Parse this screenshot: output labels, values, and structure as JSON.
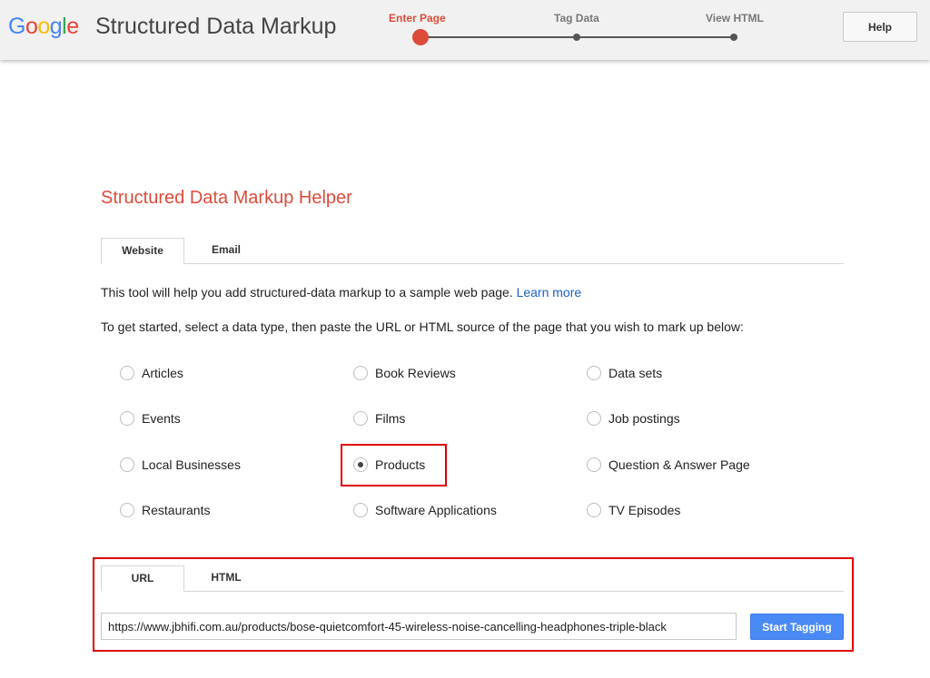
{
  "header": {
    "logo_text": "Google",
    "app_title": "Structured Data Markup",
    "steps": [
      {
        "label": "Enter Page",
        "active": true
      },
      {
        "label": "Tag Data",
        "active": false
      },
      {
        "label": "View HTML",
        "active": false
      }
    ],
    "help_label": "Help"
  },
  "main": {
    "title": "Structured Data Markup Helper",
    "source_tabs": [
      {
        "label": "Website",
        "active": true
      },
      {
        "label": "Email",
        "active": false
      }
    ],
    "intro_text": "This tool will help you add structured-data markup to a sample web page.",
    "learn_more": "Learn more",
    "instructions": "To get started, select a data type, then paste the URL or HTML source of the page that you wish to mark up below:",
    "data_types": [
      "Articles",
      "Book Reviews",
      "Data sets",
      "Events",
      "Films",
      "Job postings",
      "Local Businesses",
      "Products",
      "Question & Answer Page",
      "Restaurants",
      "Software Applications",
      "TV Episodes"
    ],
    "selected_type": "Products",
    "input_tabs": [
      {
        "label": "URL",
        "active": true
      },
      {
        "label": "HTML",
        "active": false
      }
    ],
    "url_value": "https://www.jbhifi.com.au/products/bose-quietcomfort-45-wireless-noise-cancelling-headphones-triple-black",
    "start_button": "Start Tagging"
  },
  "colors": {
    "accent_red": "#dd4b39",
    "button_blue": "#4a8af4",
    "highlight_red": "#e00000",
    "link_blue": "#1a5fc9"
  }
}
